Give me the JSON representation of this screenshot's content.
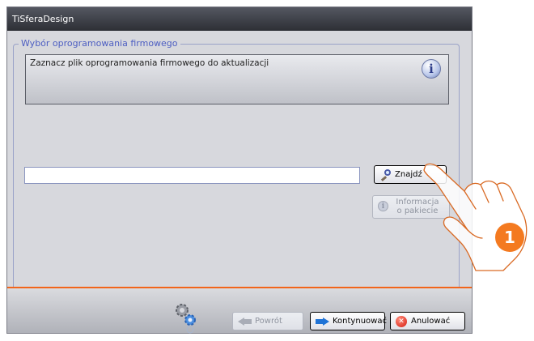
{
  "window": {
    "title": "TiSferaDesign"
  },
  "group": {
    "legend": "Wybór oprogramowania firmowego",
    "instruction": "Zaznacz plik oprogramowania firmowego do aktualizacji",
    "info_icon": "info-icon"
  },
  "file_field": {
    "value": ""
  },
  "buttons": {
    "find": "Znajdź",
    "package_info": "Informacja o pakiecie",
    "back": "Powrót",
    "next": "Kontynuować",
    "cancel": "Anulować"
  },
  "icons": {
    "find": "magnifier-icon",
    "package_info": "info-icon",
    "back": "arrow-left-icon",
    "next": "arrow-right-icon",
    "cancel": "cancel-icon",
    "status": "gears-icon"
  },
  "callout": {
    "step": "1"
  },
  "colors": {
    "accent": "#f2651b",
    "legend": "#4d5ec2",
    "primary_arrow": "#1f73d6",
    "badge": "#f47a20"
  }
}
